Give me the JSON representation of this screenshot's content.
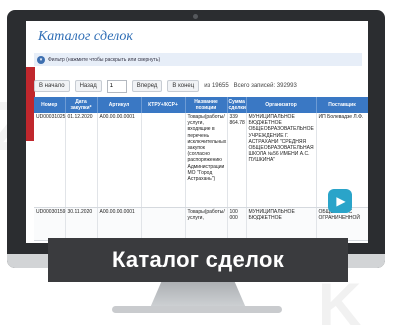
{
  "caption": "Каталог сделок",
  "app": {
    "title": "Каталог сделок",
    "filter_text": "Фильтр (нажмите чтобы раскрыть или свернуть)"
  },
  "pager": {
    "first": "В начало",
    "prev": "Назад",
    "page_value": "1",
    "next": "Вперед",
    "last": "В конец",
    "of_text": "из 19655",
    "total_text": "Всего записей: 392993"
  },
  "table": {
    "headers": [
      "Номер",
      "Дата закупки*",
      "Артикул",
      "КТРУ+/КСР+",
      "Название позиции",
      "Сумма сделки",
      "Организатор",
      "Поставщик"
    ],
    "rows": [
      [
        "UD00031025",
        "01.12.2020",
        "A00.00.00.0001",
        "",
        "Товары(работы/ услуги, входящие в перечень исключительных закупок (согласно распоряжению Администрации МО \"Город Астрахань\")",
        "339 864.78",
        "МУНИЦИПАЛЬНОЕ БЮДЖЕТНОЕ ОБЩЕОБРАЗОВАТЕЛЬНОЕ УЧРЕЖДЕНИЕ Г. АСТРАХАНИ \"СРЕДНЯЯ ОБЩЕОБРАЗОВАТЕЛЬНАЯ ШКОЛА №56 ИМЕНИ А.С. ПУШКИНА\"",
        "ИП Болевадзе Л.Ф."
      ],
      [
        "UD00030159",
        "30.11.2020",
        "A00.00.00.0001",
        "",
        "Товары(работы/ услуги,",
        "100 000",
        "МУНИЦИПАЛЬНОЕ БЮДЖЕТНОЕ",
        "ОБЩЕСТВО С ОГРАНИЧЕННОЙ"
      ]
    ]
  }
}
